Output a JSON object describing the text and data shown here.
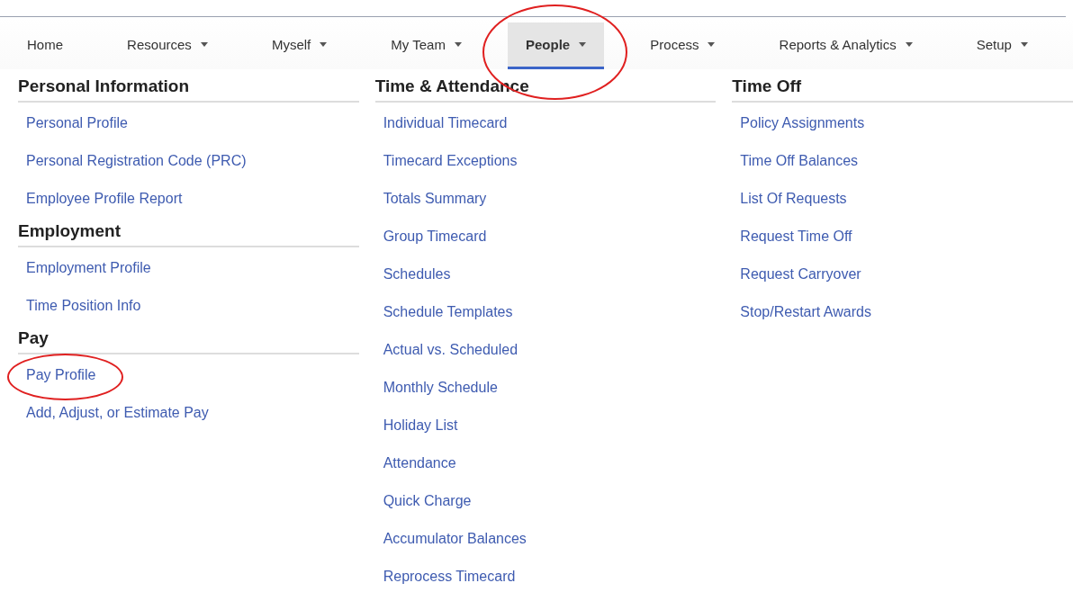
{
  "nav": [
    {
      "label": "Home",
      "dropdown": false,
      "selected": false,
      "circled": false
    },
    {
      "label": "Resources",
      "dropdown": true,
      "selected": false,
      "circled": false
    },
    {
      "label": "Myself",
      "dropdown": true,
      "selected": false,
      "circled": false
    },
    {
      "label": "My Team",
      "dropdown": true,
      "selected": false,
      "circled": false
    },
    {
      "label": "People",
      "dropdown": true,
      "selected": true,
      "circled": true
    },
    {
      "label": "Process",
      "dropdown": true,
      "selected": false,
      "circled": false
    },
    {
      "label": "Reports & Analytics",
      "dropdown": true,
      "selected": false,
      "circled": false
    },
    {
      "label": "Setup",
      "dropdown": true,
      "selected": false,
      "circled": false
    }
  ],
  "columns": [
    {
      "sections": [
        {
          "heading": "Personal Information",
          "links": [
            {
              "label": "Personal Profile",
              "circled": false
            },
            {
              "label": "Personal Registration Code (PRC)",
              "circled": false
            },
            {
              "label": "Employee Profile Report",
              "circled": false
            }
          ]
        },
        {
          "heading": "Employment",
          "links": [
            {
              "label": "Employment Profile",
              "circled": false
            },
            {
              "label": "Time Position Info",
              "circled": false
            }
          ]
        },
        {
          "heading": "Pay",
          "links": [
            {
              "label": "Pay Profile",
              "circled": true
            },
            {
              "label": "Add, Adjust, or Estimate Pay",
              "circled": false
            }
          ]
        }
      ]
    },
    {
      "sections": [
        {
          "heading": "Time & Attendance",
          "links": [
            {
              "label": "Individual Timecard",
              "circled": false
            },
            {
              "label": "Timecard Exceptions",
              "circled": false
            },
            {
              "label": "Totals Summary",
              "circled": false
            },
            {
              "label": "Group Timecard",
              "circled": false
            },
            {
              "label": "Schedules",
              "circled": false
            },
            {
              "label": "Schedule Templates",
              "circled": false
            },
            {
              "label": "Actual vs. Scheduled",
              "circled": false
            },
            {
              "label": "Monthly Schedule",
              "circled": false
            },
            {
              "label": "Holiday List",
              "circled": false
            },
            {
              "label": "Attendance",
              "circled": false
            },
            {
              "label": "Quick Charge",
              "circled": false
            },
            {
              "label": "Accumulator Balances",
              "circled": false
            },
            {
              "label": "Reprocess Timecard",
              "circled": false
            }
          ]
        }
      ]
    },
    {
      "sections": [
        {
          "heading": "Time Off",
          "links": [
            {
              "label": "Policy Assignments",
              "circled": false
            },
            {
              "label": "Time Off Balances",
              "circled": false
            },
            {
              "label": "List Of Requests",
              "circled": false
            },
            {
              "label": "Request Time Off",
              "circled": false
            },
            {
              "label": "Request Carryover",
              "circled": false
            },
            {
              "label": "Stop/Restart Awards",
              "circled": false
            }
          ]
        }
      ]
    }
  ]
}
